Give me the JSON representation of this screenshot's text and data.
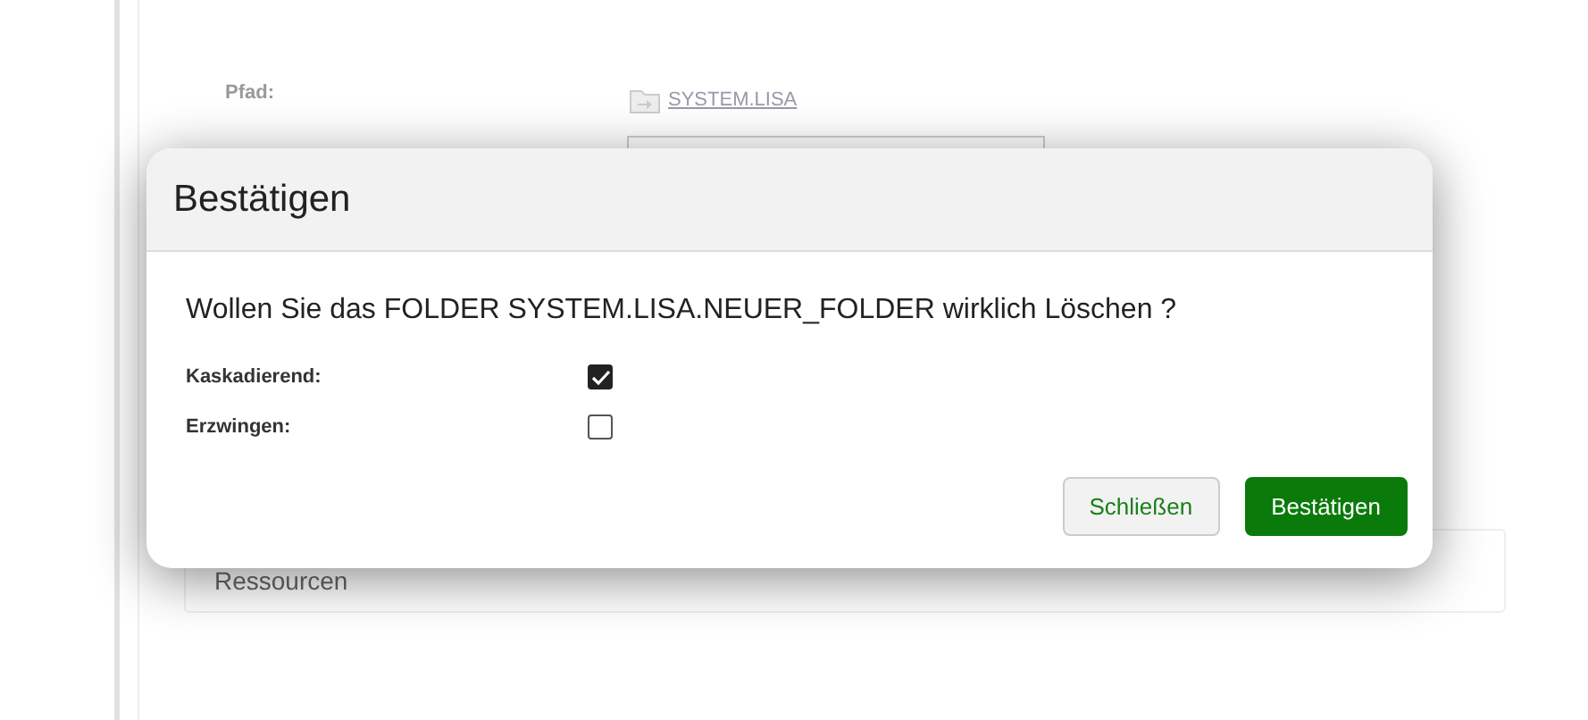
{
  "background": {
    "path_label": "Pfad:",
    "path_link": "SYSTEM.LISA",
    "section": "Ressourcen"
  },
  "dialog": {
    "title": "Bestätigen",
    "message": "Wollen Sie das FOLDER SYSTEM.LISA.NEUER_FOLDER wirklich Löschen ?",
    "options": [
      {
        "label": "Kaskadierend:",
        "checked": true
      },
      {
        "label": "Erzwingen:",
        "checked": false
      }
    ],
    "buttons": [
      {
        "label": "Schließen",
        "kind": "secondary"
      },
      {
        "label": "Bestätigen",
        "kind": "primary"
      }
    ]
  }
}
